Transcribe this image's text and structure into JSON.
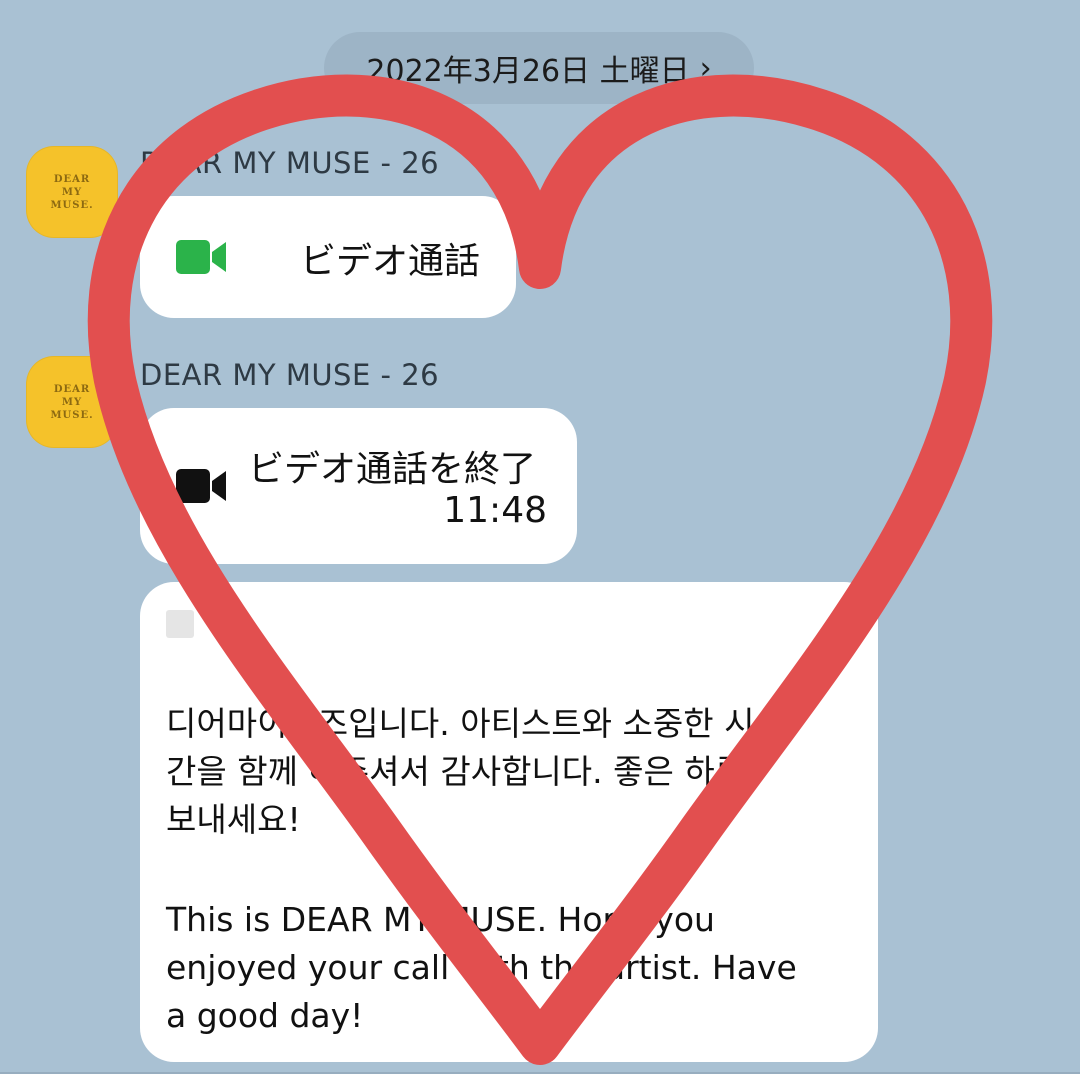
{
  "date_header": {
    "label": "2022年3月26日 土曜日",
    "chevron": "›"
  },
  "messages": [
    {
      "sender": "DEAR MY MUSE - 26",
      "avatar_text": "DEAR\nMY\nMUSE.",
      "call_label": "ビデオ通話",
      "icon": "video-camera-icon",
      "icon_color": "#2bb34a"
    },
    {
      "sender": "DEAR MY MUSE - 26",
      "avatar_text": "DEAR\nMY\nMUSE.",
      "call_label": "ビデオ通話を終了",
      "call_duration": "11:48",
      "icon": "video-camera-icon",
      "icon_color": "#111111"
    },
    {
      "text_ko": "디어마이뮤즈입니다. 아티스트와 소중한 시\n간을 함께 해주셔서 감사합니다. 좋은 하루\n보내세요!",
      "text_en": "This is DEAR MY MUSE. Hope you\nenjoyed your call with the artist. Have\na good day!"
    }
  ],
  "colors": {
    "background": "#a9c1d3",
    "bubble": "#ffffff",
    "avatar": "#f5c22a",
    "heart_overlay": "#e24f4f"
  }
}
